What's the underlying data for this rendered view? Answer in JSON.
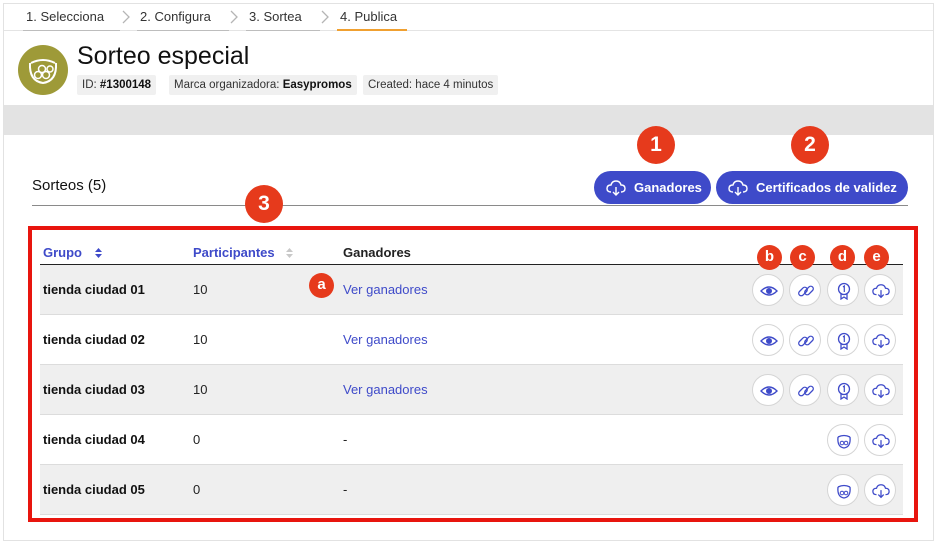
{
  "steps": [
    "1. Selecciona",
    "2. Configura",
    "3. Sortea",
    "4. Publica"
  ],
  "header": {
    "title": "Sorteo especial",
    "id_label": "ID:",
    "id_value": "#1300148",
    "brand_label": "Marca organizadora:",
    "brand_value": "Easypromos",
    "created": "Created: hace 4 minutos"
  },
  "section": {
    "title": "Sorteos (5)",
    "btn_winners": "Ganadores",
    "btn_certificates": "Certificados de validez"
  },
  "table": {
    "headers": {
      "group": "Grupo",
      "participants": "Participantes",
      "winners": "Ganadores"
    },
    "rows": [
      {
        "group": "tienda ciudad 01",
        "participants": "10",
        "winners": "Ver ganadores"
      },
      {
        "group": "tienda ciudad 02",
        "participants": "10",
        "winners": "Ver ganadores"
      },
      {
        "group": "tienda ciudad 03",
        "participants": "10",
        "winners": "Ver ganadores"
      },
      {
        "group": "tienda ciudad 04",
        "participants": "0",
        "winners": "-"
      },
      {
        "group": "tienda ciudad 05",
        "participants": "0",
        "winners": "-"
      }
    ]
  },
  "markers": {
    "m1": "1",
    "m2": "2",
    "m3": "3",
    "a": "a",
    "b": "b",
    "c": "c",
    "d": "d",
    "e": "e"
  },
  "icons": [
    "eye-icon",
    "link-icon",
    "certificate-icon",
    "cloud-download-icon",
    "draw-bowl-icon",
    "chevron-right-icon",
    "sort-icon"
  ],
  "colors": {
    "accent": "#3e4ac9",
    "marker": "#e63a1c",
    "highlight_box": "#e8150e",
    "active_step": "#f0a030",
    "logo": "#9e9a38"
  }
}
